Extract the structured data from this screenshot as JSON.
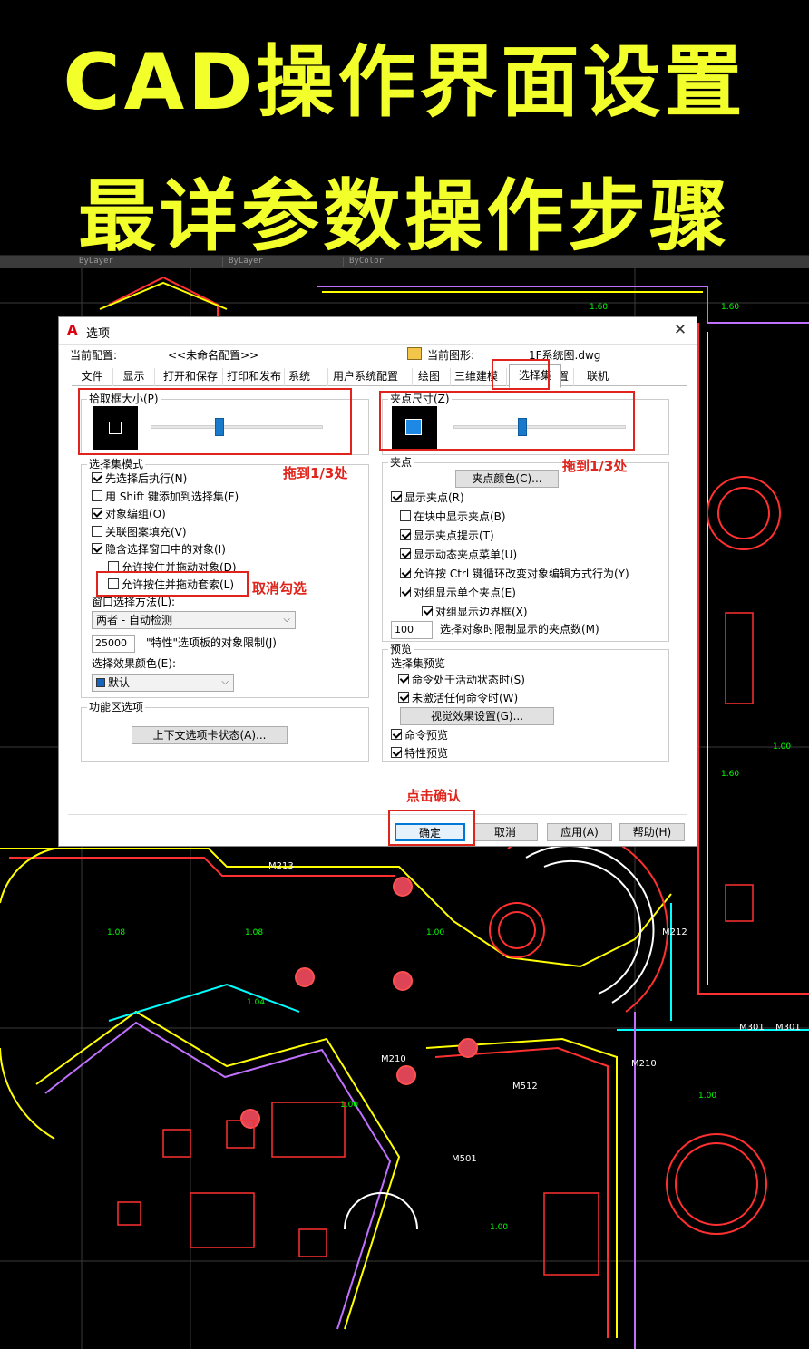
{
  "banner": {
    "line1": "CAD操作界面设置",
    "line2": "最详参数操作步骤"
  },
  "cad_toolbar": [
    "ByLayer",
    "ByLayer",
    "ByColor"
  ],
  "dialog": {
    "title": "选项",
    "profile_label": "当前配置:",
    "profile_value": "<<未命名配置>>",
    "drawing_label": "当前图形:",
    "drawing_value": "1F系统图.dwg",
    "tabs": [
      "文件",
      "显示",
      "打开和保存",
      "打印和发布",
      "系统",
      "用户系统配置",
      "绘图",
      "三维建模",
      "选择集",
      "配置",
      "联机"
    ],
    "active_tab": "选择集",
    "pickbox": {
      "label": "拾取框大小(P)",
      "level": 0.4
    },
    "grip_size": {
      "label": "夹点尺寸(Z)",
      "level": 0.4
    },
    "selection_modes": {
      "label": "选择集模式",
      "items": [
        {
          "label": "先选择后执行(N)",
          "checked": true
        },
        {
          "label": "用 Shift 键添加到选择集(F)",
          "checked": false
        },
        {
          "label": "对象编组(O)",
          "checked": true
        },
        {
          "label": "关联图案填充(V)",
          "checked": false
        },
        {
          "label": "隐含选择窗口中的对象(I)",
          "checked": true
        },
        {
          "label": "允许按住并拖动对象(D)",
          "checked": false
        },
        {
          "label": "允许按住并拖动套索(L)",
          "checked": false
        }
      ],
      "window_method_label": "窗口选择方法(L):",
      "window_method_value": "两者 - 自动检测",
      "limit_value": "25000",
      "limit_label": "\"特性\"选项板的对象限制(J)",
      "effect_color_label": "选择效果颜色(E):",
      "effect_color_value": "默认",
      "effect_color_swatch": "#1565c0"
    },
    "ribbon": {
      "label": "功能区选项",
      "button": "上下文选项卡状态(A)..."
    },
    "grips": {
      "label": "夹点",
      "color_button": "夹点颜色(C)...",
      "items": [
        {
          "label": "显示夹点(R)",
          "checked": true
        },
        {
          "label": "在块中显示夹点(B)",
          "checked": false
        },
        {
          "label": "显示夹点提示(T)",
          "checked": true
        },
        {
          "label": "显示动态夹点菜单(U)",
          "checked": true
        },
        {
          "label": "允许按 Ctrl 键循环改变对象编辑方式行为(Y)",
          "checked": true
        },
        {
          "label": "对组显示单个夹点(E)",
          "checked": true
        },
        {
          "label": "对组显示边界框(X)",
          "checked": true
        }
      ],
      "limit_value": "100",
      "limit_label": "选择对象时限制显示的夹点数(M)"
    },
    "preview": {
      "label": "预览",
      "sub_label": "选择集预览",
      "items": [
        {
          "label": "命令处于活动状态时(S)",
          "checked": true
        },
        {
          "label": "未激活任何命令时(W)",
          "checked": true
        }
      ],
      "visual_button": "视觉效果设置(G)...",
      "items2": [
        {
          "label": "命令预览",
          "checked": true
        },
        {
          "label": "特性预览",
          "checked": true
        }
      ]
    },
    "buttons": {
      "ok": "确定",
      "cancel": "取消",
      "apply": "应用(A)",
      "help": "帮助(H)"
    }
  },
  "annotations": {
    "drag_left": "拖到1/3处",
    "drag_right": "拖到1/3处",
    "uncheck": "取消勾选",
    "click_ok": "点击确认",
    "color": "#e0241b"
  },
  "colors": {
    "banner_text": "#f3ff2a",
    "slider_thumb": "#1979ca",
    "grip_preview": "#1e88e5"
  }
}
